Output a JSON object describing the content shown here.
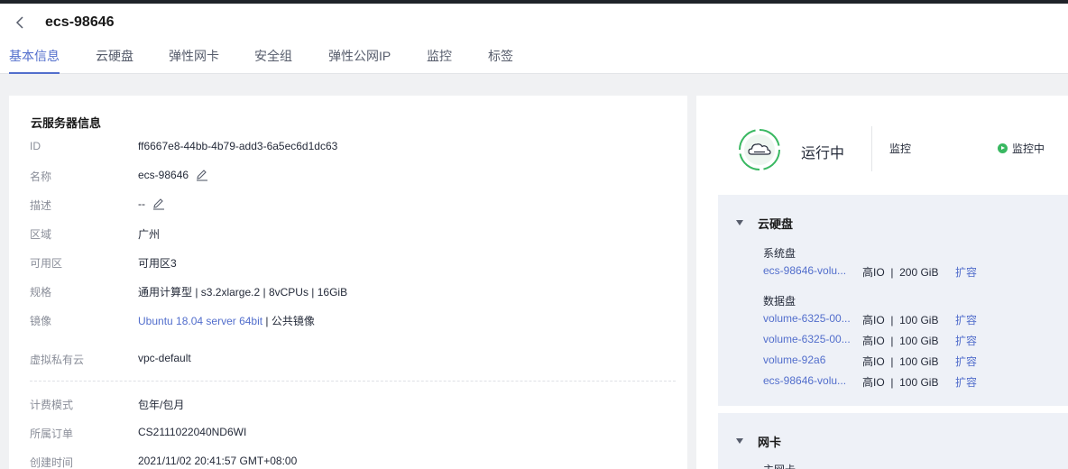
{
  "header": {
    "title": "ecs-98646",
    "tabs": [
      "基本信息",
      "云硬盘",
      "弹性网卡",
      "安全组",
      "弹性公网IP",
      "监控",
      "标签"
    ]
  },
  "server_info": {
    "title": "云服务器信息",
    "rows": {
      "id": {
        "label": "ID",
        "value": "ff6667e8-44bb-4b79-add3-6a5ec6d1dc63"
      },
      "name": {
        "label": "名称",
        "value": "ecs-98646"
      },
      "desc": {
        "label": "描述",
        "value": "--"
      },
      "region": {
        "label": "区域",
        "value": "广州"
      },
      "az": {
        "label": "可用区",
        "value": "可用区3"
      },
      "flavor": {
        "label": "规格",
        "value": "通用计算型 | s3.2xlarge.2 | 8vCPUs | 16GiB"
      },
      "image": {
        "label": "镜像",
        "value_link": "Ubuntu 18.04 server 64bit",
        "value_suffix": " | 公共镜像"
      },
      "vpc": {
        "label": "虚拟私有云",
        "value": "vpc-default"
      },
      "billing": {
        "label": "计费模式",
        "value": "包年/包月"
      },
      "order": {
        "label": "所属订单",
        "value": "CS2111022040ND6WI"
      },
      "created": {
        "label": "创建时间",
        "value": "2021/11/02 20:41:57 GMT+08:00"
      }
    }
  },
  "status": {
    "text": "运行中",
    "monitor_label": "监控",
    "monitor_status": "监控中",
    "accent": "#39b861"
  },
  "disks": {
    "title": "云硬盘",
    "system_label": "系统盘",
    "data_label": "数据盘",
    "expand_label": "扩容",
    "system": [
      {
        "name": "ecs-98646-volu...",
        "spec": "高IO  |  200 GiB"
      }
    ],
    "data": [
      {
        "name": "volume-6325-00...",
        "spec": "高IO  |  100 GiB"
      },
      {
        "name": "volume-6325-00...",
        "spec": "高IO  |  100 GiB"
      },
      {
        "name": "volume-92a6",
        "spec": "高IO  |  100 GiB"
      },
      {
        "name": "ecs-98646-volu...",
        "spec": "高IO  |  100 GiB"
      }
    ]
  },
  "nic": {
    "title": "网卡",
    "primary_label": "主网卡"
  },
  "colors": {
    "link": "#526ecc",
    "accent_tab": "#526ecc"
  }
}
